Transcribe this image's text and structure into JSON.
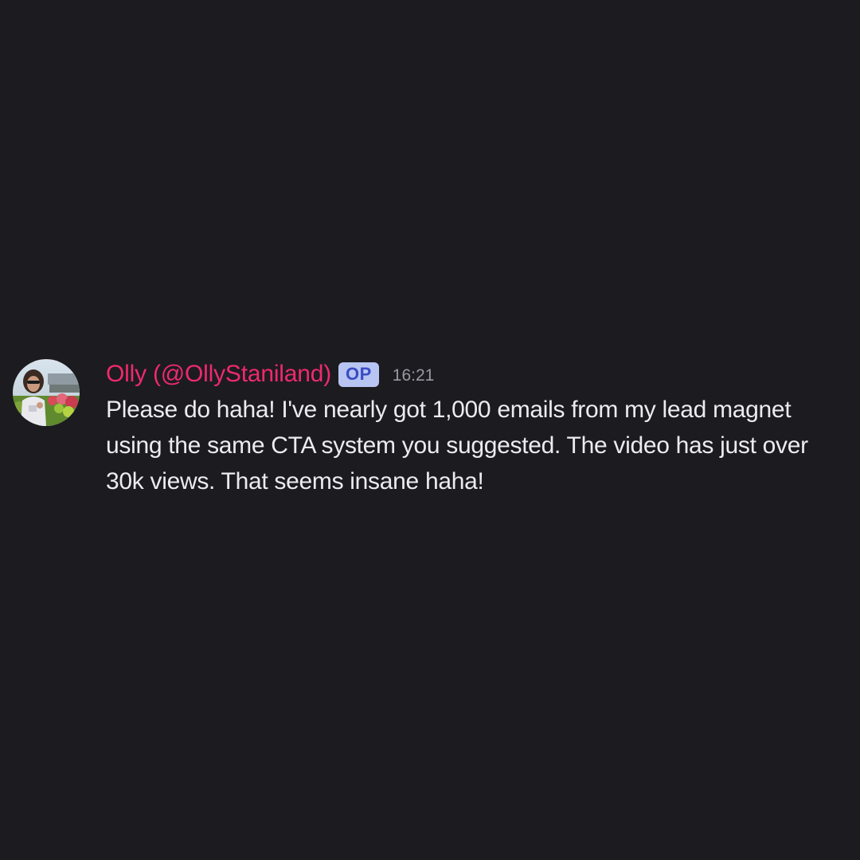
{
  "message": {
    "author": "Olly (@OllyStaniland)",
    "badge": "OP",
    "timestamp": "16:21",
    "text": "Please do haha! I've nearly got 1,000 emails from my lead magnet using the same CTA system you suggested. The video has just over 30k views. That seems insane haha!",
    "avatar_icon": "user-photo-avatar"
  },
  "colors": {
    "background": "#1c1b20",
    "author": "#ee2a6b",
    "badge_bg": "#b8c5f2",
    "badge_text": "#3a4cc4",
    "timestamp": "#9a99a3",
    "text": "#ecebef"
  }
}
